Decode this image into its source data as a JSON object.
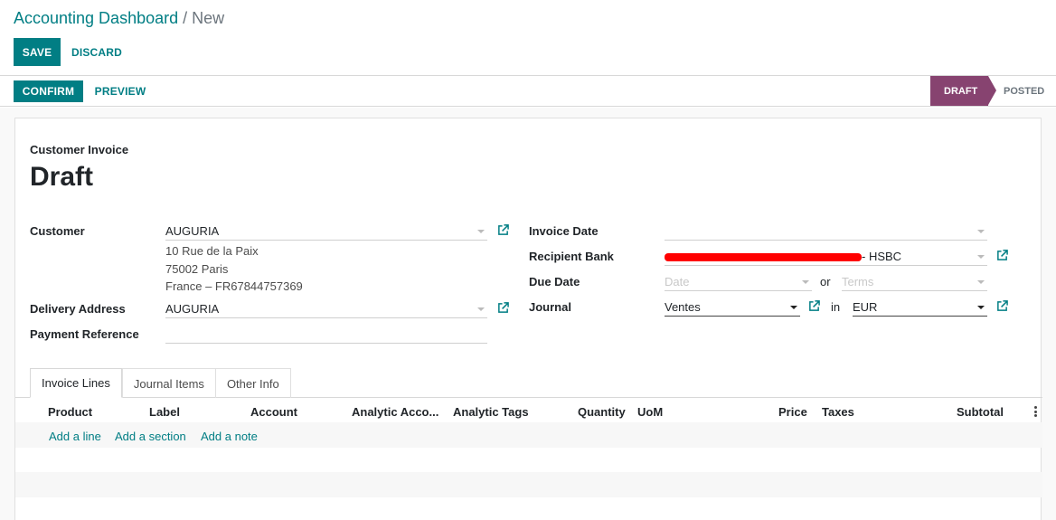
{
  "breadcrumb": {
    "parent": "Accounting Dashboard",
    "separator": "/",
    "current": "New"
  },
  "toolbar": {
    "save_label": "SAVE",
    "discard_label": "DISCARD"
  },
  "statusbar": {
    "confirm_label": "CONFIRM",
    "preview_label": "PREVIEW",
    "stages": [
      {
        "label": "DRAFT",
        "active": true
      },
      {
        "label": "POSTED",
        "active": false
      }
    ],
    "active_color": "#874370"
  },
  "invoice": {
    "type_label": "Customer Invoice",
    "title": "Draft",
    "customer": {
      "label": "Customer",
      "value": "AUGURIA",
      "address_lines": [
        "10 Rue de la Paix",
        "75002 Paris",
        "France – FR67844757369"
      ]
    },
    "delivery_address": {
      "label": "Delivery Address",
      "value": "AUGURIA"
    },
    "payment_reference": {
      "label": "Payment Reference",
      "value": ""
    },
    "invoice_date": {
      "label": "Invoice Date",
      "value": ""
    },
    "recipient_bank": {
      "label": "Recipient Bank",
      "value_suffix": "- HSBC"
    },
    "due_date": {
      "label": "Due Date",
      "date_placeholder": "Date",
      "or_label": "or",
      "terms_placeholder": "Terms"
    },
    "journal": {
      "label": "Journal",
      "value": "Ventes",
      "in_label": "in",
      "currency": "EUR"
    }
  },
  "tabs": [
    {
      "label": "Invoice Lines",
      "active": true
    },
    {
      "label": "Journal Items",
      "active": false
    },
    {
      "label": "Other Info",
      "active": false
    }
  ],
  "lines_table": {
    "columns": [
      "Product",
      "Label",
      "Account",
      "Analytic Acco...",
      "Analytic Tags",
      "Quantity",
      "UoM",
      "Price",
      "Taxes",
      "Subtotal"
    ],
    "add_links": [
      "Add a line",
      "Add a section",
      "Add a note"
    ]
  },
  "colors": {
    "accent": "#017e84",
    "redaction": "#ff0000"
  }
}
